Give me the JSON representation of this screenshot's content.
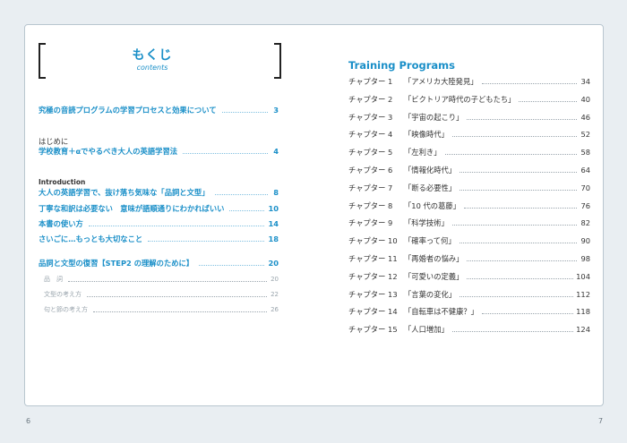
{
  "left_page": {
    "heading": "もくじ",
    "subheading": "contents",
    "entry_study": {
      "title": "究極の音読プログラムの学習プロセスと効果について",
      "page": "3"
    },
    "hajimeni": "はじめに",
    "entry_school": {
      "title": "学校教育＋αでやるべき大人の英語学習法",
      "page": "4"
    },
    "intro_label": "Introduction",
    "intro_items": [
      {
        "title": "大人の英語学習で、抜け落ち気味な「品詞と文型」",
        "page": "8"
      },
      {
        "title": "丁寧な和訳は必要ない　意味が語順通りにわかればいい",
        "page": "10"
      },
      {
        "title": "本書の使い方",
        "page": "14"
      },
      {
        "title": "さいごに…もっとも大切なこと",
        "page": "18"
      }
    ],
    "review": {
      "title": "品詞と文型の復習【STEP2 の理解のために】",
      "page": "20"
    },
    "review_items": [
      {
        "title": "品　詞",
        "page": "20"
      },
      {
        "title": "文型の考え方",
        "page": "22"
      },
      {
        "title": "句と節の考え方",
        "page": "26"
      }
    ],
    "page_number": "6"
  },
  "right_page": {
    "heading": "Training Programs",
    "chapters": [
      {
        "chapter": "チャプター 1",
        "title": "「アメリカ大陸発見」",
        "page": "34"
      },
      {
        "chapter": "チャプター 2",
        "title": "「ビクトリア時代の子どもたち」",
        "page": "40"
      },
      {
        "chapter": "チャプター 3",
        "title": "「宇宙の起こり」",
        "page": "46"
      },
      {
        "chapter": "チャプター 4",
        "title": "「映像時代」",
        "page": "52"
      },
      {
        "chapter": "チャプター 5",
        "title": "「左利き」",
        "page": "58"
      },
      {
        "chapter": "チャプター 6",
        "title": "「情報化時代」",
        "page": "64"
      },
      {
        "chapter": "チャプター 7",
        "title": "「断る必要性」",
        "page": "70"
      },
      {
        "chapter": "チャプター 8",
        "title": "「10 代の葛藤」",
        "page": "76"
      },
      {
        "chapter": "チャプター 9",
        "title": "「科学技術」",
        "page": "82"
      },
      {
        "chapter": "チャプター 10",
        "title": "「確率って何」",
        "page": "90"
      },
      {
        "chapter": "チャプター 11",
        "title": "「再婚者の悩み」",
        "page": "98"
      },
      {
        "chapter": "チャプター 12",
        "title": "「可愛いの定義」",
        "page": "104"
      },
      {
        "chapter": "チャプター 13",
        "title": "「言葉の変化」",
        "page": "112"
      },
      {
        "chapter": "チャプター 14",
        "title": "「自転車は不健康？」",
        "page": "118"
      },
      {
        "chapter": "チャプター 15",
        "title": "「人口増加」",
        "page": "124"
      }
    ],
    "page_number": "7"
  }
}
